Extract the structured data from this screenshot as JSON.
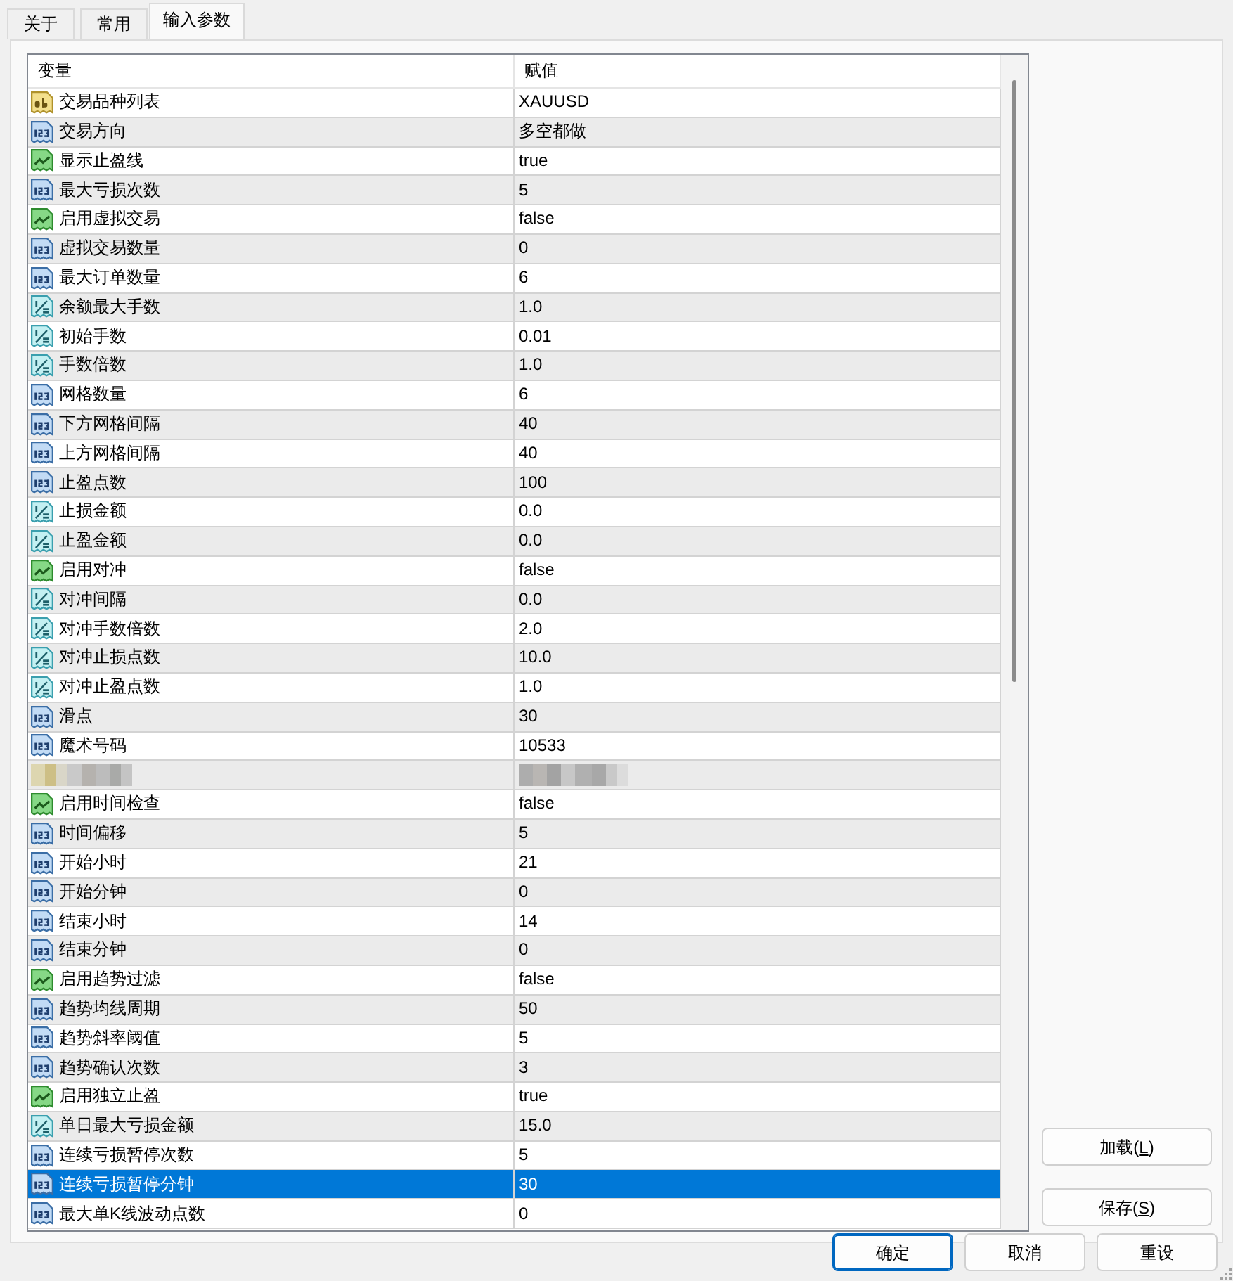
{
  "tabs": [
    {
      "label": "关于",
      "selected": false
    },
    {
      "label": "常用",
      "selected": false
    },
    {
      "label": "输入参数",
      "selected": true
    }
  ],
  "table": {
    "columns": [
      "变量",
      "赋值"
    ],
    "rows": [
      {
        "kind": "string",
        "name": "交易品种列表",
        "value": "XAUUSD",
        "selected": false
      },
      {
        "kind": "int",
        "name": "交易方向",
        "value": "多空都做",
        "selected": false
      },
      {
        "kind": "bool",
        "name": "显示止盈线",
        "value": "true",
        "selected": false
      },
      {
        "kind": "int",
        "name": "最大亏损次数",
        "value": "5",
        "selected": false
      },
      {
        "kind": "bool",
        "name": "启用虚拟交易",
        "value": "false",
        "selected": false
      },
      {
        "kind": "int",
        "name": "虚拟交易数量",
        "value": "0",
        "selected": false
      },
      {
        "kind": "int",
        "name": "最大订单数量",
        "value": "6",
        "selected": false
      },
      {
        "kind": "double",
        "name": "余额最大手数",
        "value": "1.0",
        "selected": false
      },
      {
        "kind": "double",
        "name": "初始手数",
        "value": "0.01",
        "selected": false
      },
      {
        "kind": "double",
        "name": "手数倍数",
        "value": "1.0",
        "selected": false
      },
      {
        "kind": "int",
        "name": "网格数量",
        "value": "6",
        "selected": false
      },
      {
        "kind": "int",
        "name": "下方网格间隔",
        "value": "40",
        "selected": false
      },
      {
        "kind": "int",
        "name": "上方网格间隔",
        "value": "40",
        "selected": false
      },
      {
        "kind": "int",
        "name": "止盈点数",
        "value": "100",
        "selected": false
      },
      {
        "kind": "double",
        "name": "止损金额",
        "value": "0.0",
        "selected": false
      },
      {
        "kind": "double",
        "name": "止盈金额",
        "value": "0.0",
        "selected": false
      },
      {
        "kind": "bool",
        "name": "启用对冲",
        "value": "false",
        "selected": false
      },
      {
        "kind": "double",
        "name": "对冲间隔",
        "value": "0.0",
        "selected": false
      },
      {
        "kind": "double",
        "name": "对冲手数倍数",
        "value": "2.0",
        "selected": false
      },
      {
        "kind": "double",
        "name": "对冲止损点数",
        "value": "10.0",
        "selected": false
      },
      {
        "kind": "double",
        "name": "对冲止盈点数",
        "value": "1.0",
        "selected": false
      },
      {
        "kind": "int",
        "name": "滑点",
        "value": "30",
        "selected": false
      },
      {
        "kind": "int",
        "name": "魔术号码",
        "value": "10533",
        "selected": false
      },
      {
        "kind": "redacted",
        "selected": false
      },
      {
        "kind": "bool",
        "name": "启用时间检查",
        "value": "false",
        "selected": false
      },
      {
        "kind": "int",
        "name": "时间偏移",
        "value": "5",
        "selected": false
      },
      {
        "kind": "int",
        "name": "开始小时",
        "value": "21",
        "selected": false
      },
      {
        "kind": "int",
        "name": "开始分钟",
        "value": "0",
        "selected": false
      },
      {
        "kind": "int",
        "name": "结束小时",
        "value": "14",
        "selected": false
      },
      {
        "kind": "int",
        "name": "结束分钟",
        "value": "0",
        "selected": false
      },
      {
        "kind": "bool",
        "name": "启用趋势过滤",
        "value": "false",
        "selected": false
      },
      {
        "kind": "int",
        "name": "趋势均线周期",
        "value": "50",
        "selected": false
      },
      {
        "kind": "int",
        "name": "趋势斜率阈值",
        "value": "5",
        "selected": false
      },
      {
        "kind": "int",
        "name": "趋势确认次数",
        "value": "3",
        "selected": false
      },
      {
        "kind": "bool",
        "name": "启用独立止盈",
        "value": "true",
        "selected": false
      },
      {
        "kind": "double",
        "name": "单日最大亏损金额",
        "value": "15.0",
        "selected": false
      },
      {
        "kind": "int",
        "name": "连续亏损暂停次数",
        "value": "5",
        "selected": false
      },
      {
        "kind": "int",
        "name": "连续亏损暂停分钟",
        "value": "30",
        "selected": true
      },
      {
        "kind": "int",
        "name": "最大单K线波动点数",
        "value": "0",
        "selected": false
      }
    ]
  },
  "side_buttons": [
    {
      "text": "加载(",
      "mnemonic": "L",
      "text_after": ")"
    },
    {
      "text": "保存(",
      "mnemonic": "S",
      "text_after": ")"
    }
  ],
  "buttons": [
    {
      "label": "确定",
      "default": true
    },
    {
      "label": "取消",
      "default": false
    },
    {
      "label": "重设",
      "default": false
    }
  ]
}
